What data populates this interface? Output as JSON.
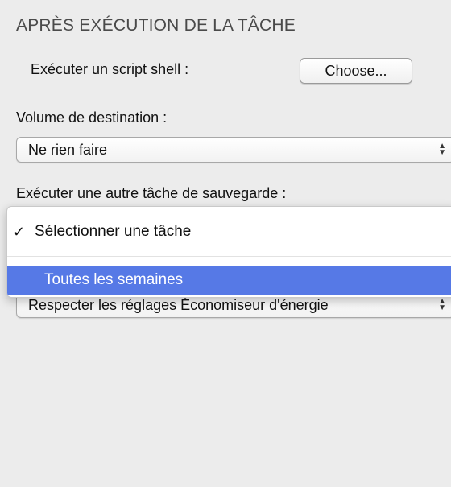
{
  "section": {
    "title": "APRÈS EXÉCUTION DE LA TÂCHE"
  },
  "shell_script": {
    "label": "Exécuter un script shell :",
    "button_label": "Choose..."
  },
  "destination_volume": {
    "label": "Volume de destination :",
    "selected": "Ne rien faire"
  },
  "other_backup_task": {
    "label": "Exécuter une autre tâche de sauvegarde :",
    "menu_open": true,
    "menu_items": [
      {
        "label": "Sélectionner une tâche",
        "checked": true
      },
      {
        "label": "Toutes les semaines",
        "highlighted": true
      }
    ]
  },
  "energy_saver": {
    "selected": "Respecter les réglages Économiseur d'énergie"
  },
  "icons": {
    "checkmark": "checkmark-icon",
    "popup_arrows": "updown-arrows-icon"
  },
  "colors": {
    "background": "#ececec",
    "menu_highlight": "#5679e6"
  }
}
